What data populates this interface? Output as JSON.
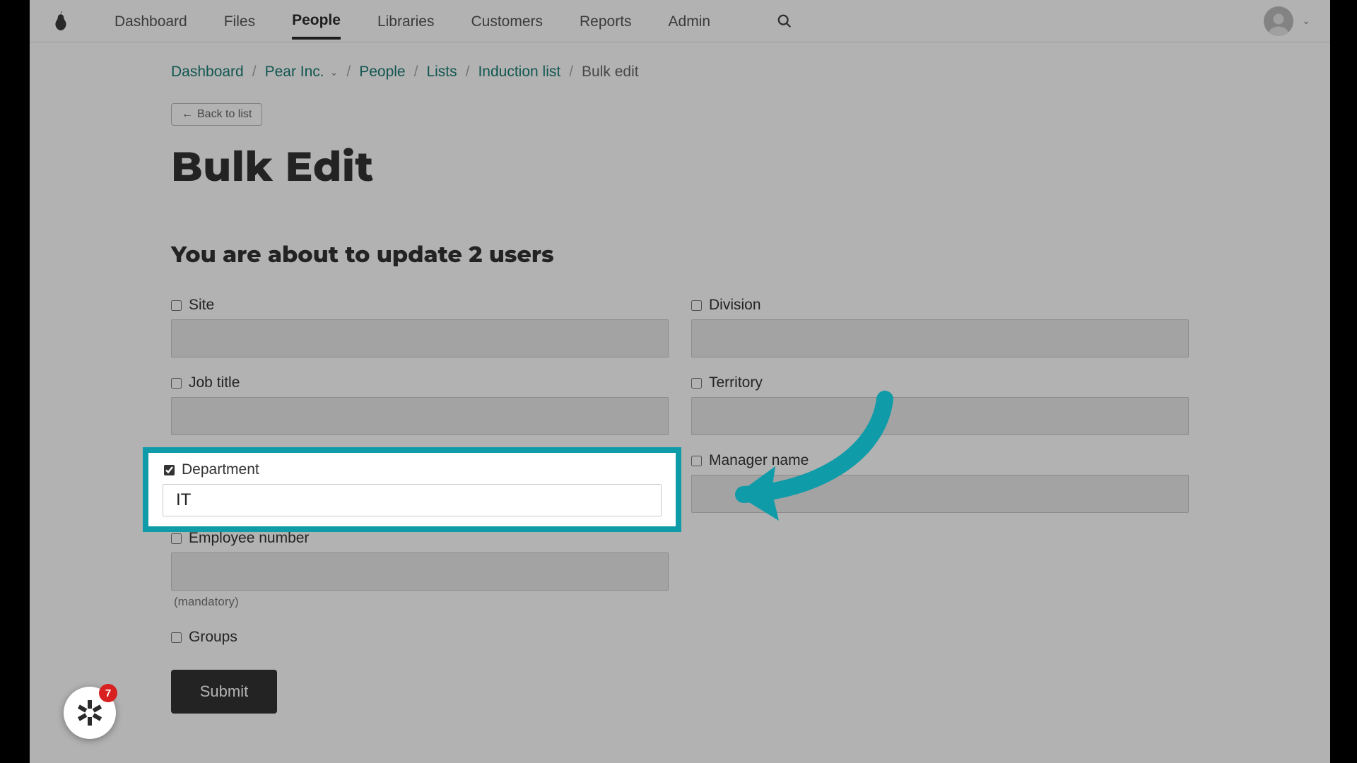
{
  "nav": {
    "items": [
      "Dashboard",
      "Files",
      "People",
      "Libraries",
      "Customers",
      "Reports",
      "Admin"
    ],
    "active_index": 2
  },
  "breadcrumb": {
    "dashboard": "Dashboard",
    "company": "Pear Inc.",
    "people": "People",
    "lists": "Lists",
    "listname": "Induction list",
    "current": "Bulk edit"
  },
  "back_button": "Back to list",
  "page_title": "Bulk Edit",
  "subtitle": "You are about to update 2 users",
  "fields": {
    "site": {
      "label": "Site",
      "checked": false,
      "value": ""
    },
    "division": {
      "label": "Division",
      "checked": false,
      "value": ""
    },
    "job_title": {
      "label": "Job title",
      "checked": false,
      "value": ""
    },
    "territory": {
      "label": "Territory",
      "checked": false,
      "value": ""
    },
    "department": {
      "label": "Department",
      "checked": true,
      "value": "IT"
    },
    "manager_name": {
      "label": "Manager name",
      "checked": false,
      "value": ""
    },
    "employee_number": {
      "label": "Employee number",
      "checked": false,
      "value": "",
      "hint": "(mandatory)"
    },
    "groups": {
      "label": "Groups",
      "checked": false
    }
  },
  "submit_label": "Submit",
  "widget": {
    "badge_count": "7"
  }
}
